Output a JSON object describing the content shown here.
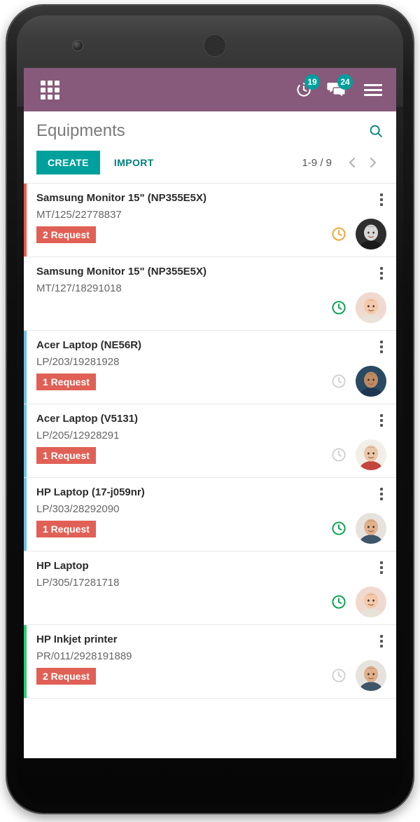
{
  "appbar": {
    "apps_icon": "apps-grid-icon",
    "activity": {
      "icon": "activity-clock-icon",
      "badge": "19"
    },
    "messages": {
      "icon": "chat-bubbles-icon",
      "badge": "24"
    },
    "menu_icon": "hamburger-menu-icon",
    "background": "#875A7B"
  },
  "control_panel": {
    "title": "Equipments",
    "search_icon": "search-icon",
    "create_label": "CREATE",
    "import_label": "IMPORT",
    "pager_label": "1-9 / 9",
    "prev_icon": "chevron-left-icon",
    "next_icon": "chevron-right-icon",
    "accent": "#00A09D"
  },
  "colors": {
    "brand_purple": "#875A7B",
    "teal": "#00A09D",
    "request_red": "#E06055",
    "accent_red": "#F0584A",
    "accent_blue": "#6EC1E4",
    "accent_green": "#2ECC71",
    "clock_orange": "#F0A030",
    "clock_green": "#00A04A",
    "clock_grey": "#D0D0D0"
  },
  "list": {
    "rows": [
      {
        "name": "Samsung Monitor 15\" (NP355E5X)",
        "reference": "MT/125/22778837",
        "request_badge": "2 Request",
        "accent_color": "#F0584A",
        "status_icon": "clock-icon",
        "status_color": "#F0A030",
        "avatar": "avatar-woman-bw",
        "menu_icon": "kebab-menu-icon"
      },
      {
        "name": "Samsung Monitor 15\" (NP355E5X)",
        "reference": "MT/127/18291018",
        "request_badge": "",
        "accent_color": "transparent",
        "status_icon": "clock-icon",
        "status_color": "#00A04A",
        "avatar": "avatar-woman-red",
        "menu_icon": "kebab-menu-icon"
      },
      {
        "name": "Acer Laptop (NE56R)",
        "reference": "LP/203/19281928",
        "request_badge": "1 Request",
        "accent_color": "#6EC1E4",
        "status_icon": "clock-icon",
        "status_color": "#D0D0D0",
        "avatar": "avatar-man-dark",
        "menu_icon": "kebab-menu-icon"
      },
      {
        "name": "Acer Laptop (V5131)",
        "reference": "LP/205/12928291",
        "request_badge": "1 Request",
        "accent_color": "#6EC1E4",
        "status_icon": "clock-icon",
        "status_color": "#D0D0D0",
        "avatar": "avatar-young-man",
        "menu_icon": "kebab-menu-icon"
      },
      {
        "name": "HP Laptop (17-j059nr)",
        "reference": "LP/303/28292090",
        "request_badge": "1 Request",
        "accent_color": "#6EC1E4",
        "status_icon": "clock-icon",
        "status_color": "#00A04A",
        "avatar": "avatar-man-beard",
        "menu_icon": "kebab-menu-icon"
      },
      {
        "name": "HP Laptop",
        "reference": "LP/305/17281718",
        "request_badge": "",
        "accent_color": "transparent",
        "status_icon": "clock-icon",
        "status_color": "#00A04A",
        "avatar": "avatar-woman-red",
        "menu_icon": "kebab-menu-icon"
      },
      {
        "name": "HP Inkjet printer",
        "reference": "PR/011/2928191889",
        "request_badge": "2 Request",
        "accent_color": "#2ECC71",
        "status_icon": "clock-icon",
        "status_color": "#D0D0D0",
        "avatar": "avatar-man-beard",
        "menu_icon": "kebab-menu-icon"
      }
    ]
  }
}
